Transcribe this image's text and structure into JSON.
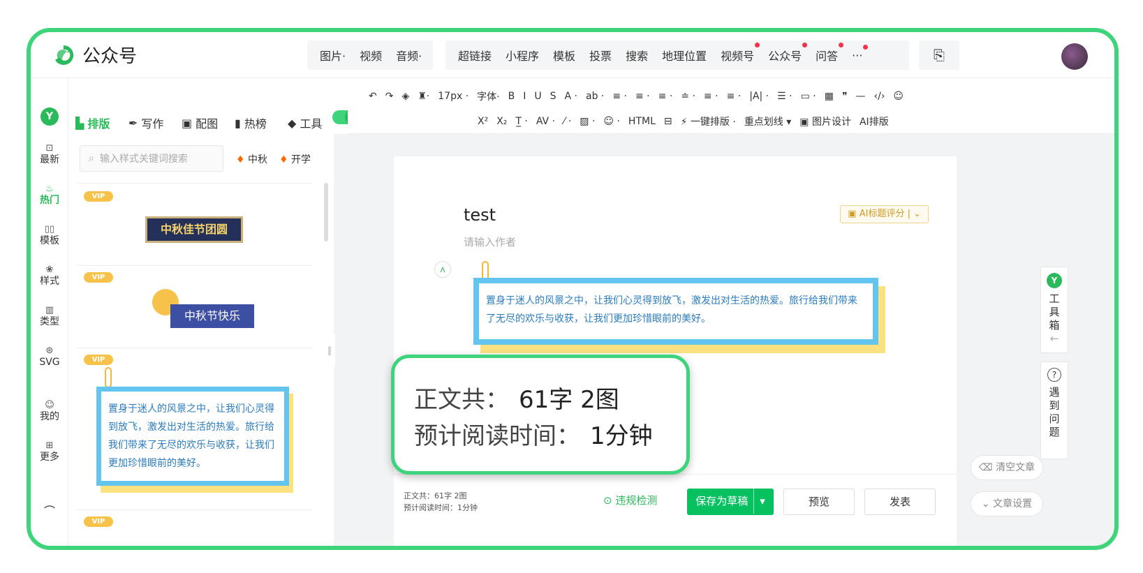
{
  "app": {
    "title": "公众号"
  },
  "topbar": {
    "media_items": [
      "图片·",
      "视频",
      "音频·"
    ],
    "insert_items": [
      {
        "label": "超链接",
        "dot": false
      },
      {
        "label": "小程序",
        "dot": false
      },
      {
        "label": "模板",
        "dot": false
      },
      {
        "label": "投票",
        "dot": false
      },
      {
        "label": "搜索",
        "dot": false
      },
      {
        "label": "地理位置",
        "dot": false
      },
      {
        "label": "视频号",
        "dot": true
      },
      {
        "label": "公众号",
        "dot": true
      },
      {
        "label": "问答",
        "dot": true
      },
      {
        "label": "···",
        "dot": true
      }
    ]
  },
  "rail": {
    "items": [
      {
        "label": "最新",
        "icon": "new-icon",
        "glyph": "⊡"
      },
      {
        "label": "热门",
        "icon": "fire-icon",
        "glyph": "♨",
        "active": true
      },
      {
        "label": "模板",
        "icon": "template-icon",
        "glyph": "▯▯"
      },
      {
        "label": "样式",
        "icon": "style-icon",
        "glyph": "❀"
      },
      {
        "label": "类型",
        "icon": "type-icon",
        "glyph": "▥"
      },
      {
        "label": "SVG",
        "icon": "svg-icon",
        "glyph": "⊛"
      },
      {
        "label": "我的",
        "icon": "user-icon",
        "glyph": "☺"
      },
      {
        "label": "更多",
        "icon": "more-icon",
        "glyph": "⊞"
      }
    ]
  },
  "tabs": [
    {
      "label": "排版",
      "icon": "layout-icon",
      "glyph": "▙",
      "active": true
    },
    {
      "label": "写作",
      "icon": "write-icon",
      "glyph": "✒"
    },
    {
      "label": "配图",
      "icon": "image-icon",
      "glyph": "▣"
    },
    {
      "label": "热榜",
      "icon": "bookmark-icon",
      "glyph": "▮"
    },
    {
      "label": "工具",
      "icon": "tool-icon",
      "glyph": "◆"
    }
  ],
  "toolbar": {
    "row1": [
      "↶",
      "↷",
      "◈",
      "♜·",
      "17px ·",
      "字体·",
      "B",
      "I",
      "U",
      "S",
      "A ·",
      "ab ·",
      "≡ ·",
      "≡ ·",
      "≡ ·",
      "≐ ·",
      "≡ ·",
      "≡ ·",
      "|A| ·",
      "☰ ·",
      "▭ ·",
      "▦",
      "❞",
      "—",
      "‹/›",
      "☺"
    ],
    "row2": [
      "X²",
      "X₂",
      "T̲ ·",
      "AV ·",
      "⁄ ·",
      "▨ ·",
      "☺ ·",
      "HTML",
      "⊟",
      "⚡ 一键排版 ·",
      "重点划线 ▾",
      "▣ 图片设计",
      "AI排版"
    ]
  },
  "panel": {
    "search_placeholder": "输入样式关键词搜索",
    "hot_tags": [
      "中秋",
      "开学"
    ],
    "vip_label": "VIP",
    "style1": "中秋佳节团圆",
    "style2": "中秋节快乐",
    "style3_text": "置身于迷人的风景之中，让我们心灵得到放飞，激发出对生活的热爱。旅行给我们带来了无尽的欢乐与收获，让我们更加珍惜眼前的美好。"
  },
  "editor": {
    "title": "test",
    "author_placeholder": "请输入作者",
    "ai_button": "AI标题评分",
    "card_text": "置身于迷人的风景之中，让我们心灵得到放飞，激发出对生活的热爱。旅行给我们带来了无尽的欢乐与收获，让我们更加珍惜眼前的美好。"
  },
  "bottombar": {
    "word_count_label": "正文共：",
    "word_count_value": "61字 2图",
    "reading_time_label": "预计阅读时间：",
    "reading_time_value": "1分钟",
    "check_label": "违规检测",
    "save_label": "保存为草稿",
    "preview_label": "预览",
    "publish_label": "发表"
  },
  "side": {
    "toolbox": "工具箱",
    "help": "遇到问题",
    "clear": "清空文章",
    "settings": "文章设置"
  },
  "colors": {
    "accent": "#2aba5b",
    "frame": "#3ed47b",
    "card_border": "#63c4ee",
    "card_shadow": "#fbe17f",
    "vip": "#f6c24a"
  }
}
